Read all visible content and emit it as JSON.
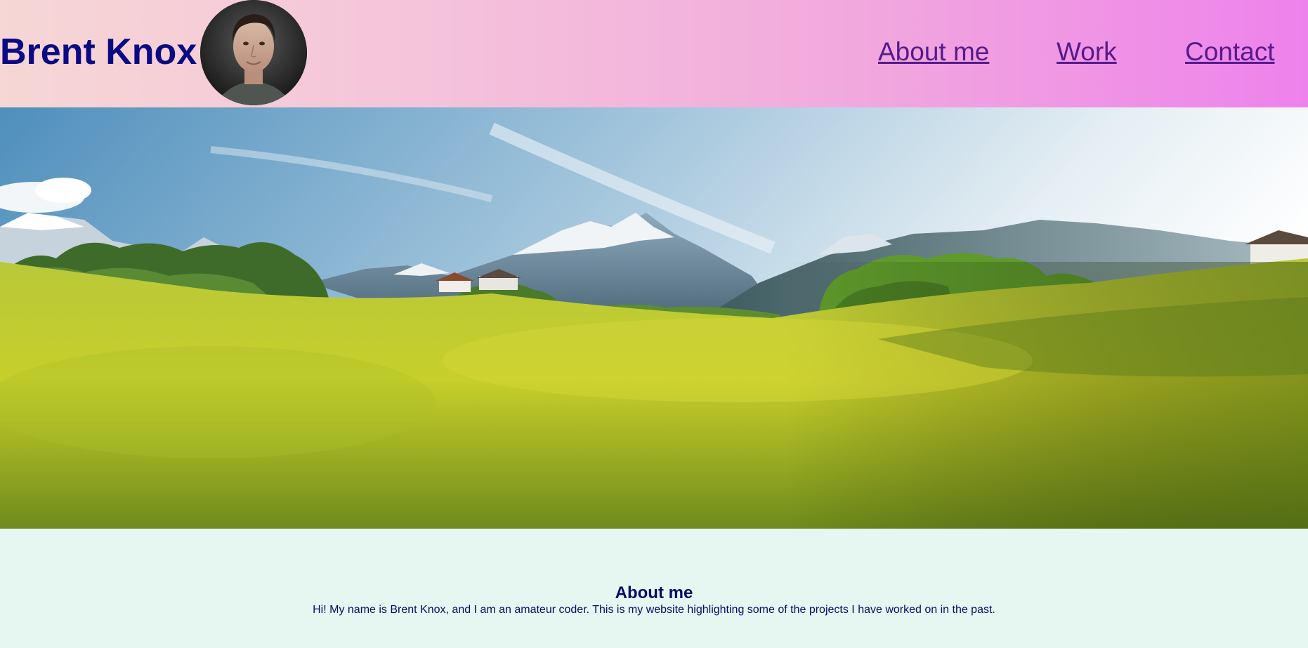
{
  "header": {
    "site_title": "Brent Knox",
    "avatar_alt": "Portrait of Brent Knox"
  },
  "nav": {
    "items": [
      {
        "label": "About me"
      },
      {
        "label": "Work"
      },
      {
        "label": "Contact"
      }
    ]
  },
  "hero": {
    "alt": "Mountain landscape with green meadow"
  },
  "about": {
    "heading": "About me",
    "text": "Hi! My name is Brent Knox, and I am an amateur coder. This is my website highlighting some of the projects I have worked on in the past."
  },
  "colors": {
    "title": "#0b0a85",
    "link": "#551a8b",
    "header_gradient_start": "#f6d7d5",
    "header_gradient_end": "#ee82ec",
    "about_background": "#e6f7f1"
  }
}
